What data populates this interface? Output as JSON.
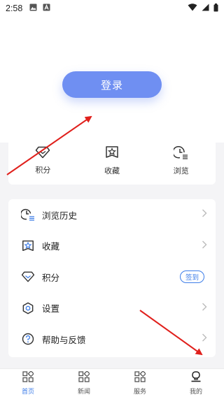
{
  "status_bar": {
    "time": "2:58",
    "icons": [
      "image-icon",
      "letter-a-icon",
      "wifi-icon",
      "signal-icon",
      "battery-icon"
    ]
  },
  "header": {
    "login_label": "登录",
    "accent": "#6f8ff2"
  },
  "stats": [
    {
      "label": "积分",
      "icon": "diamond-icon"
    },
    {
      "label": "收藏",
      "icon": "star-icon"
    },
    {
      "label": "浏览",
      "icon": "history-icon"
    }
  ],
  "menu": [
    {
      "label": "浏览历史",
      "icon": "history-icon"
    },
    {
      "label": "收藏",
      "icon": "star-icon"
    },
    {
      "label": "积分",
      "icon": "diamond-icon",
      "badge": "签到"
    },
    {
      "label": "设置",
      "icon": "gear-icon"
    },
    {
      "label": "帮助与反馈",
      "icon": "help-icon"
    }
  ],
  "tabs": [
    {
      "label": "首页",
      "icon": "home-grid-icon",
      "active": true
    },
    {
      "label": "新闻",
      "icon": "news-grid-icon",
      "active": false
    },
    {
      "label": "服务",
      "icon": "service-grid-icon",
      "active": false
    },
    {
      "label": "我的",
      "icon": "profile-icon",
      "active": false
    }
  ],
  "colors": {
    "badge": "#3d7de8",
    "tab_active": "#3d7de8",
    "annotation_arrow": "#e0201c"
  }
}
